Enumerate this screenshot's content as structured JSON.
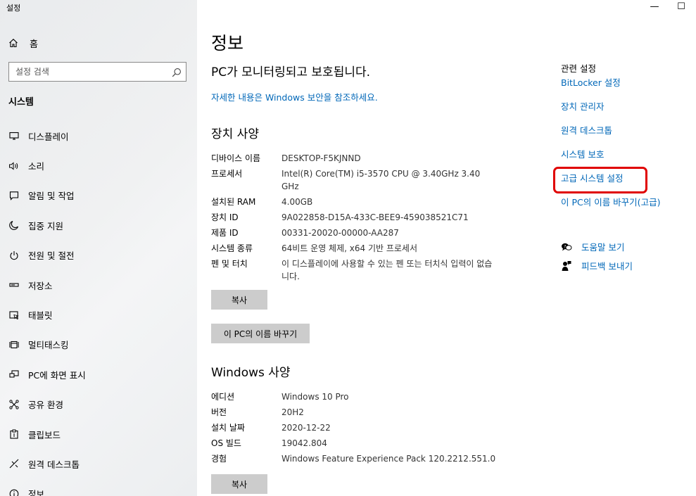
{
  "window": {
    "title": "설정",
    "minimize_glyph": "—",
    "maximize_glyph": "☐"
  },
  "sidebar": {
    "home_label": "홈",
    "search_placeholder": "설정 검색",
    "section_title": "시스템",
    "items": [
      {
        "label": "디스플레이",
        "icon": "monitor-icon"
      },
      {
        "label": "소리",
        "icon": "speaker-icon"
      },
      {
        "label": "알림 및 작업",
        "icon": "message-icon"
      },
      {
        "label": "집중 지원",
        "icon": "moon-icon"
      },
      {
        "label": "전원 및 절전",
        "icon": "power-icon"
      },
      {
        "label": "저장소",
        "icon": "drive-icon"
      },
      {
        "label": "태블릿",
        "icon": "tablet-icon"
      },
      {
        "label": "멀티태스킹",
        "icon": "multitask-icon"
      },
      {
        "label": "PC에 화면 표시",
        "icon": "project-icon"
      },
      {
        "label": "공유 환경",
        "icon": "share-icon"
      },
      {
        "label": "클립보드",
        "icon": "clipboard-icon"
      },
      {
        "label": "원격 데스크톱",
        "icon": "remote-desktop-icon"
      },
      {
        "label": "정보",
        "icon": "info-icon"
      }
    ]
  },
  "main": {
    "title": "정보",
    "protection_status": "PC가 모니터링되고 보호됩니다.",
    "security_link": "자세한 내용은 Windows 보안을 참조하세요.",
    "device_specs": {
      "heading": "장치 사양",
      "rows": [
        {
          "key": "디바이스 이름",
          "value": "DESKTOP-F5KJNND"
        },
        {
          "key": "프로세서",
          "value": "Intel(R) Core(TM) i5-3570 CPU @ 3.40GHz   3.40 GHz"
        },
        {
          "key": "설치된 RAM",
          "value": "4.00GB"
        },
        {
          "key": "장치 ID",
          "value": "9A022858-D15A-433C-BEE9-459038521C71"
        },
        {
          "key": "제품 ID",
          "value": "00331-20020-00000-AA287"
        },
        {
          "key": "시스템 종류",
          "value": "64비트 운영 체제, x64 기반 프로세서"
        },
        {
          "key": "펜 및 터치",
          "value": "이 디스플레이에 사용할 수 있는 펜 또는 터치식 입력이 없습니다."
        }
      ],
      "copy_button": "복사",
      "rename_button": "이 PC의 이름 바꾸기"
    },
    "windows_specs": {
      "heading": "Windows 사양",
      "rows": [
        {
          "key": "에디션",
          "value": "Windows 10 Pro"
        },
        {
          "key": "버전",
          "value": "20H2"
        },
        {
          "key": "설치 날짜",
          "value": "2020-12-22"
        },
        {
          "key": "OS 빌드",
          "value": "19042.804"
        },
        {
          "key": "경험",
          "value": "Windows Feature Experience Pack 120.2212.551.0"
        }
      ],
      "copy_button": "복사"
    }
  },
  "related": {
    "title": "관련 설정",
    "links": [
      "BitLocker 설정",
      "장치 관리자",
      "원격 데스크톱",
      "시스템 보호",
      "고급 시스템 설정",
      "이 PC의 이름 바꾸기(고급)"
    ],
    "highlighted_link": "고급 시스템 설정",
    "highlight_color": "#e00000",
    "help_label": "도움말 보기",
    "feedback_label": "피드백 보내기"
  },
  "colors": {
    "link": "#0067b8",
    "button_bg": "#cccccc"
  }
}
